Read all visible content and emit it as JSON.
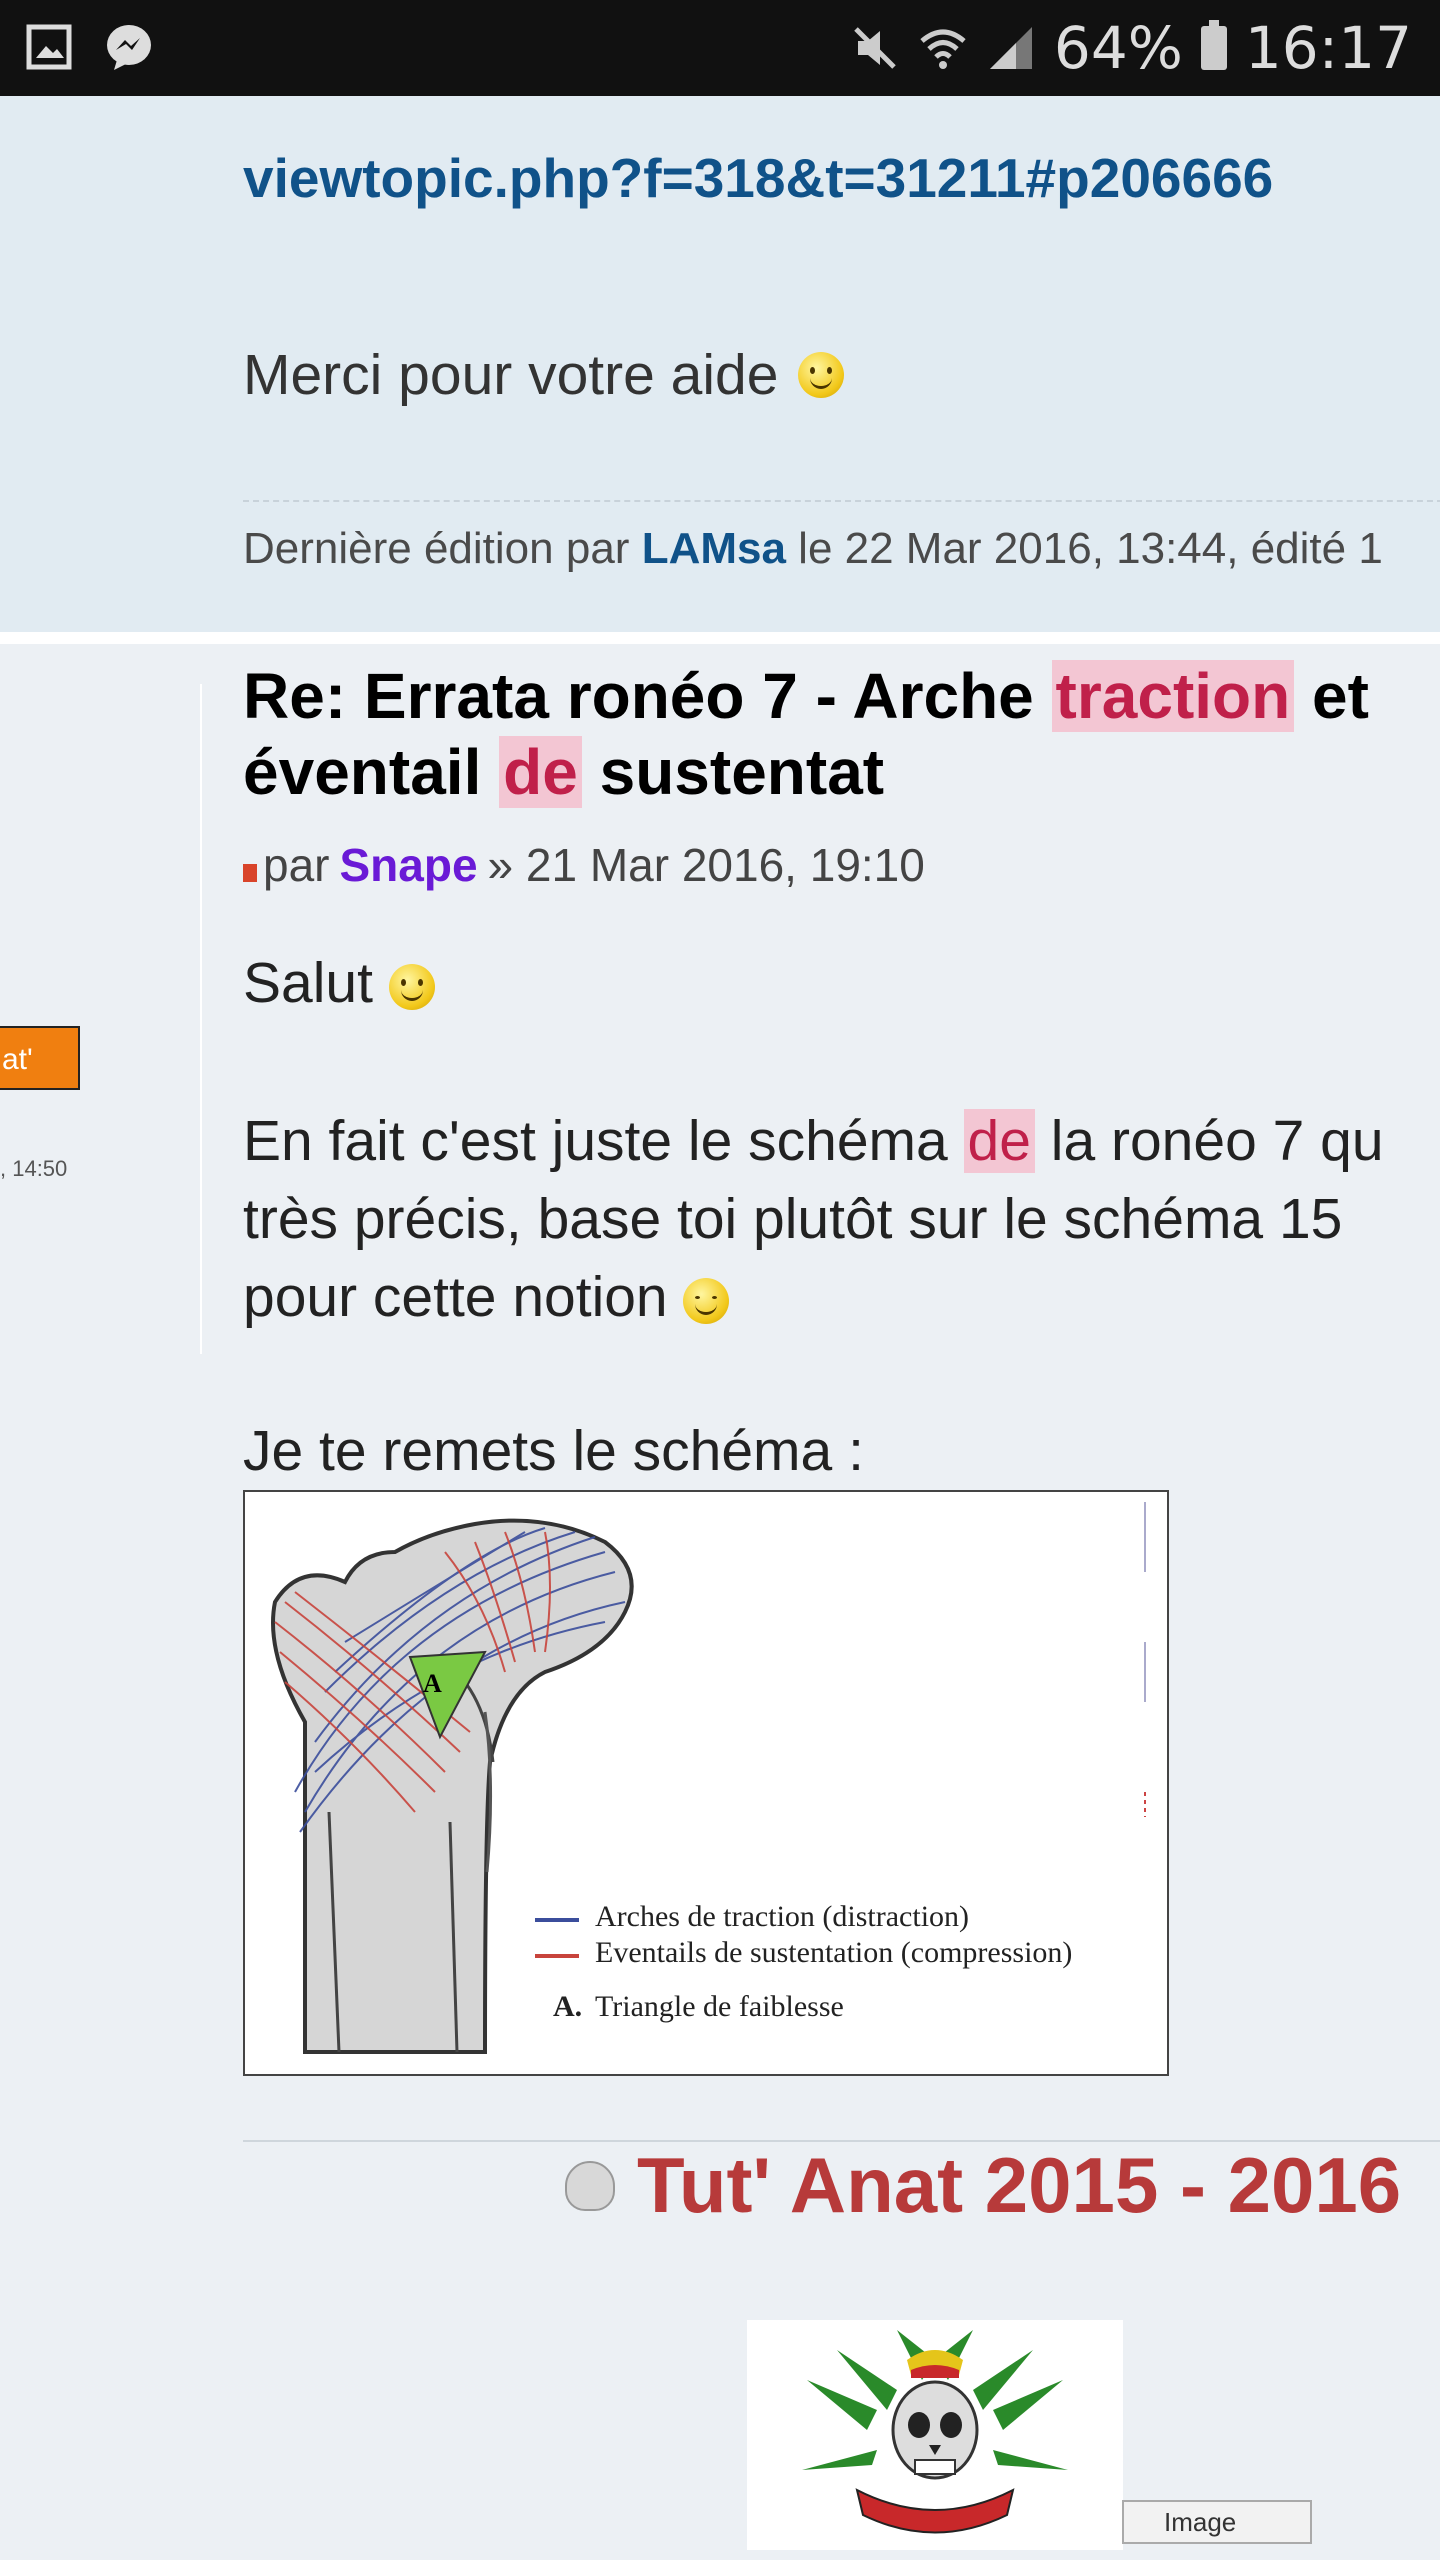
{
  "status_bar": {
    "battery": "64%",
    "time": "16:17"
  },
  "prev_post": {
    "link": "viewtopic.php?f=318&t=31211#p206666",
    "message": "Merci pour votre aide",
    "edit_note": {
      "prefix": "Dernière édition par",
      "user": "LAMsa",
      "suffix": "le 22 Mar 2016, 13:44, édité 1"
    }
  },
  "sidebar": {
    "rank_button": "at'",
    "time": ", 14:50"
  },
  "post": {
    "title": {
      "part1": "Re: Errata ronéo 7 - Arche ",
      "hl1": "traction",
      "part2": " et",
      "part3": "éventail ",
      "hl2": "de",
      "part4": " sustentat"
    },
    "meta": {
      "by": "par",
      "author": "Snape",
      "date": "» 21 Mar 2016, 19:10"
    },
    "greeting": "Salut",
    "line1": {
      "a": "En fait c'est juste le schéma ",
      "hl": "de",
      "b": " la ronéo 7 qu"
    },
    "line2": "très précis, base toi plutôt sur le schéma 15",
    "line3": "pour cette notion",
    "line4": "Je te remets le schéma :",
    "schema": {
      "label_a": "A",
      "legend_blue": "Arches de traction (distraction)",
      "legend_red": "Eventails de sustentation (compression)",
      "legend_a_key": "A.",
      "legend_a": "Triangle de faiblesse",
      "colors": {
        "traction": "#3b4e9c",
        "sustentation": "#c8443c",
        "triangle": "#7ac943"
      }
    },
    "signature": {
      "title": "Tut' Anat 2015 - 2016",
      "broken_image_alt": "Image"
    }
  }
}
